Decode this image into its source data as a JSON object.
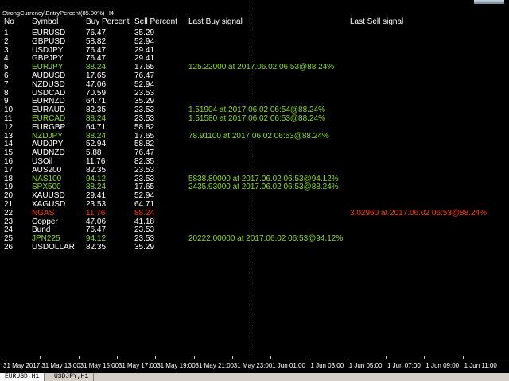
{
  "title": "StrongCurrency\\EntryPercent(85.00%) H4",
  "headers": {
    "no": "No",
    "symbol": "Symbol",
    "buy": "Buy Percent",
    "sell": "Sell Percent",
    "buy_signal": "Last Buy signal",
    "sell_signal": "Last Sell signal"
  },
  "colors": {
    "green": "#8bdc1b",
    "red": "#ff3c00",
    "white": "#ffffff"
  },
  "rows": [
    {
      "no": "1",
      "symbol": "EURUSD",
      "buy": "76.47",
      "sell": "35.29",
      "buy_signal": "",
      "sell_signal": "",
      "style": "white"
    },
    {
      "no": "2",
      "symbol": "GBPUSD",
      "buy": "58.82",
      "sell": "52.94",
      "buy_signal": "",
      "sell_signal": "",
      "style": "white"
    },
    {
      "no": "3",
      "symbol": "USDJPY",
      "buy": "76.47",
      "sell": "29.41",
      "buy_signal": "",
      "sell_signal": "",
      "style": "white"
    },
    {
      "no": "4",
      "symbol": "GBPJPY",
      "buy": "76.47",
      "sell": "29.41",
      "buy_signal": "",
      "sell_signal": "",
      "style": "white"
    },
    {
      "no": "5",
      "symbol": "EURJPY",
      "buy": "88.24",
      "sell": "17.65",
      "buy_signal": "125.22000 at 2017.06.02 06:53@88.24%",
      "sell_signal": "",
      "style": "buy"
    },
    {
      "no": "6",
      "symbol": "AUDUSD",
      "buy": "17.65",
      "sell": "76.47",
      "buy_signal": "",
      "sell_signal": "",
      "style": "white"
    },
    {
      "no": "7",
      "symbol": "NZDUSD",
      "buy": "47.06",
      "sell": "52.94",
      "buy_signal": "",
      "sell_signal": "",
      "style": "white"
    },
    {
      "no": "8",
      "symbol": "USDCAD",
      "buy": "70.59",
      "sell": "23.53",
      "buy_signal": "",
      "sell_signal": "",
      "style": "white"
    },
    {
      "no": "9",
      "symbol": "EURNZD",
      "buy": "64.71",
      "sell": "35.29",
      "buy_signal": "",
      "sell_signal": "",
      "style": "white"
    },
    {
      "no": "10",
      "symbol": "EURAUD",
      "buy": "82.35",
      "sell": "23.53",
      "buy_signal": "1.51904 at 2017.06.02 06:54@88.24%",
      "sell_signal": "",
      "style": "white"
    },
    {
      "no": "11",
      "symbol": "EURCAD",
      "buy": "88.24",
      "sell": "23.53",
      "buy_signal": "1.51580 at 2017.06.02 06:53@88.24%",
      "sell_signal": "",
      "style": "buy"
    },
    {
      "no": "12",
      "symbol": "EURGBP",
      "buy": "64.71",
      "sell": "58.82",
      "buy_signal": "",
      "sell_signal": "",
      "style": "white"
    },
    {
      "no": "13",
      "symbol": "NZDJPY",
      "buy": "88.24",
      "sell": "17.65",
      "buy_signal": "78.91100 at 2017.06.02 06:53@88.24%",
      "sell_signal": "",
      "style": "buy"
    },
    {
      "no": "14",
      "symbol": "AUDJPY",
      "buy": "52.94",
      "sell": "58.82",
      "buy_signal": "",
      "sell_signal": "",
      "style": "white"
    },
    {
      "no": "15",
      "symbol": "AUDNZD",
      "buy": "5.88",
      "sell": "76.47",
      "buy_signal": "",
      "sell_signal": "",
      "style": "white"
    },
    {
      "no": "16",
      "symbol": "USOil",
      "buy": "11.76",
      "sell": "82.35",
      "buy_signal": "",
      "sell_signal": "",
      "style": "white"
    },
    {
      "no": "17",
      "symbol": "AUS200",
      "buy": "82.35",
      "sell": "23.53",
      "buy_signal": "",
      "sell_signal": "",
      "style": "white"
    },
    {
      "no": "18",
      "symbol": "NAS100",
      "buy": "94.12",
      "sell": "23.53",
      "buy_signal": "5838.80000 at 2017.06.02 06:53@94.12%",
      "sell_signal": "",
      "style": "buy"
    },
    {
      "no": "19",
      "symbol": "SPX500",
      "buy": "88.24",
      "sell": "17.65",
      "buy_signal": "2435.93000 at 2017.06.02 06:53@88.24%",
      "sell_signal": "",
      "style": "buy"
    },
    {
      "no": "20",
      "symbol": "XAUUSD",
      "buy": "29.41",
      "sell": "52.94",
      "buy_signal": "",
      "sell_signal": "",
      "style": "white"
    },
    {
      "no": "21",
      "symbol": "XAGUSD",
      "buy": "23.53",
      "sell": "64.71",
      "buy_signal": "",
      "sell_signal": "",
      "style": "white"
    },
    {
      "no": "22",
      "symbol": "NGAS",
      "buy": "11.76",
      "sell": "88.24",
      "buy_signal": "",
      "sell_signal": "3.02960 at 2017.06.02 06:53@88.24%",
      "style": "sell"
    },
    {
      "no": "23",
      "symbol": "Copper",
      "buy": "47.06",
      "sell": "41.18",
      "buy_signal": "",
      "sell_signal": "",
      "style": "white"
    },
    {
      "no": "24",
      "symbol": "Bund",
      "buy": "76.47",
      "sell": "23.53",
      "buy_signal": "",
      "sell_signal": "",
      "style": "white"
    },
    {
      "no": "25",
      "symbol": "JPN225",
      "buy": "94.12",
      "sell": "23.53",
      "buy_signal": "20222.00000 at 2017.06.02 06:53@94.12%",
      "sell_signal": "",
      "style": "buy"
    },
    {
      "no": "26",
      "symbol": "USDOLLAR",
      "buy": "82.35",
      "sell": "35.29",
      "buy_signal": "",
      "sell_signal": "",
      "style": "white"
    }
  ],
  "x_axis_labels": [
    "31 May 2017",
    "31 May 13:00",
    "31 May 15:00",
    "31 May 17:00",
    "31 May 19:00",
    "31 May 21:00",
    "31 May 23:00",
    "1 Jun 01:00",
    "1 Jun 03:00",
    "1 Jun 05:00",
    "1 Jun 07:00",
    "1 Jun 09:00",
    "1 Jun 11:00"
  ],
  "tabs": [
    {
      "label": "EURUSD,H1",
      "active": true
    },
    {
      "label": "USDJPY,H1",
      "active": false
    }
  ]
}
